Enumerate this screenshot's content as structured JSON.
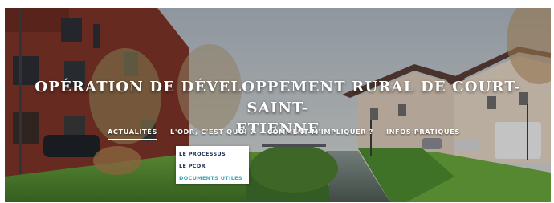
{
  "hero": {
    "title_line1": "OPÉRATION DE DÉVELOPPEMENT RURAL DE COURT-SAINT-",
    "title_line2": "ETIENNE"
  },
  "nav": {
    "items": [
      {
        "label": "ACTUALITÉS",
        "active": true
      },
      {
        "label": "L'ODR, C'EST QUOI ?",
        "active": false
      },
      {
        "label": "COMMENT M'IMPLIQUER ?",
        "active": false
      },
      {
        "label": "INFOS PRATIQUES",
        "active": false
      }
    ]
  },
  "dropdown": {
    "items": [
      {
        "label": "LE PROCESSUS",
        "color": "#1b2a55"
      },
      {
        "label": "LE PCDR",
        "color": "#1b2a55"
      },
      {
        "label": "DOCUMENTS UTILES",
        "color": "#3aa8b8"
      }
    ]
  },
  "colors": {
    "sky": "#c7cfd6",
    "grass": "#5f9a3a",
    "brick": "#8c3b2c",
    "water": "#6f7e7a"
  }
}
